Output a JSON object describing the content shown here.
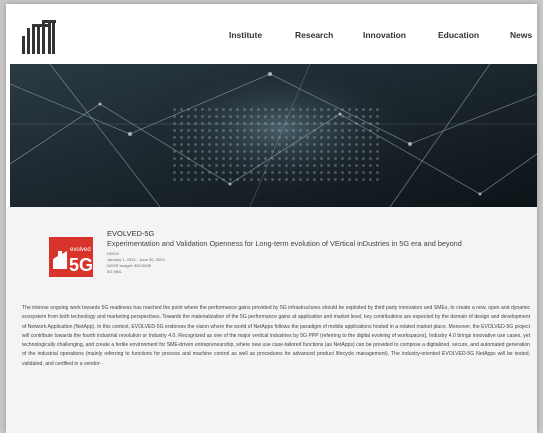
{
  "header": {
    "logo_icon": "intt-logo-icon",
    "nav": [
      "Institute",
      "Research",
      "Innovation",
      "Education",
      "News"
    ]
  },
  "hero": {
    "image_icon": "network-circuit-banner"
  },
  "project": {
    "badge_icon": "evolved-5g-badge",
    "badge_small": "evolved",
    "badge_big": "5G",
    "title": "EVOLVED-5G",
    "subtitle": "Experimentation and Validation Openness for Long-term evolution of VErtical inDustries in 5G era and beyond",
    "meta": [
      "H2020",
      "January 1, 2021 - June 30, 2023",
      "NGSR budget: 852.000€",
      "5G MNL"
    ]
  },
  "description": "The intense ongoing work towards 5G readiness has reached the point where the performance gains provided by 5G infrastructures should be exploited by third party innovators and SMEs, to create a new, open and dynamic ecosystem from both technology and marketing perspectives. Towards the materialization of the 5G performance gains at application and market level, key contributions are expected by the domain of design and development of Network Application (NetApp). In this context, EVOLVED-5G endorses the vision where the world of NetApps follows the paradigm of mobile applications hosted in a related market place. Moreover, the EVOLVED-5G project will contribute towards the fourth industrial revolution or Industry 4.0. Recognized as one of the major vertical industries by 5G PPP (referring to the digital evolving of workspaces), Industry 4.0 brings innovative use cases, yet technologically challenging, and create a fertile environment for SME-driven entrepreneurship, where new use case-tailored functions (as NetApps) can be provided to compose a digitalized, secure, and automated generation of the industrial operations (mainly referring to functions for process and machine control as well as procedures for advanced product lifecycle management). The industry-oriented EVOLVED-5G NetApps will be tested, validated, and certified in a vendor-",
  "colors": {
    "accent": "#d9342b",
    "page_bg": "#ffffff",
    "content_bg": "#f4f4f4"
  }
}
